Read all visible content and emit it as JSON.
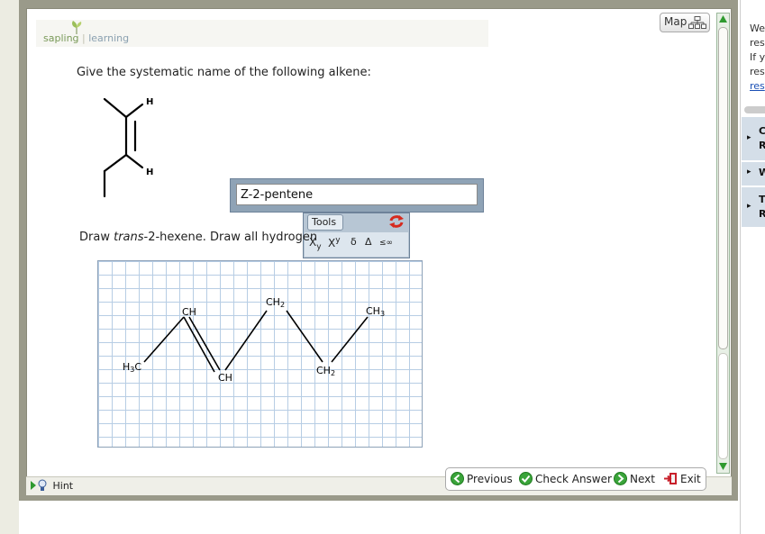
{
  "logo": {
    "part1": "sapling",
    "part2": "learning"
  },
  "map_button": {
    "label": "Map"
  },
  "question1": {
    "prompt": "Give the systematic name of the following alkene:",
    "h_top": "H",
    "h_bottom": "H"
  },
  "answer": {
    "value": "Z-2-pentene"
  },
  "tools": {
    "tab_label": "Tools",
    "subscript": "X",
    "subscript_sub": "y",
    "superscript": "X",
    "superscript_sup": "y",
    "delta_small": "δ",
    "delta_cap": "Δ",
    "leq_inf": "≤∞"
  },
  "question2": {
    "prefix": "Draw ",
    "italic": "trans",
    "suffix": "-2-hexene. Draw all hydrogen"
  },
  "structure2": {
    "h3c": "H",
    "h3c_sub": "3",
    "h3c_c": "C",
    "ch_a": "CH",
    "ch_b": "CH",
    "ch2_a": "CH",
    "ch2_a_sub": "2",
    "ch2_b": "CH",
    "ch2_b_sub": "2",
    "ch3": "CH",
    "ch3_sub": "3"
  },
  "bottom": {
    "hint": "Hint",
    "previous": "Previous",
    "check": "Check Answer",
    "next": "Next",
    "exit": "Exit"
  },
  "right_panel": {
    "l1": "We",
    "l2": "res",
    "l3": "If y",
    "l4": "res",
    "link": "res",
    "box1a": "C",
    "box1b": "R",
    "box2": "W",
    "box3a": "T",
    "box3b": "R"
  }
}
